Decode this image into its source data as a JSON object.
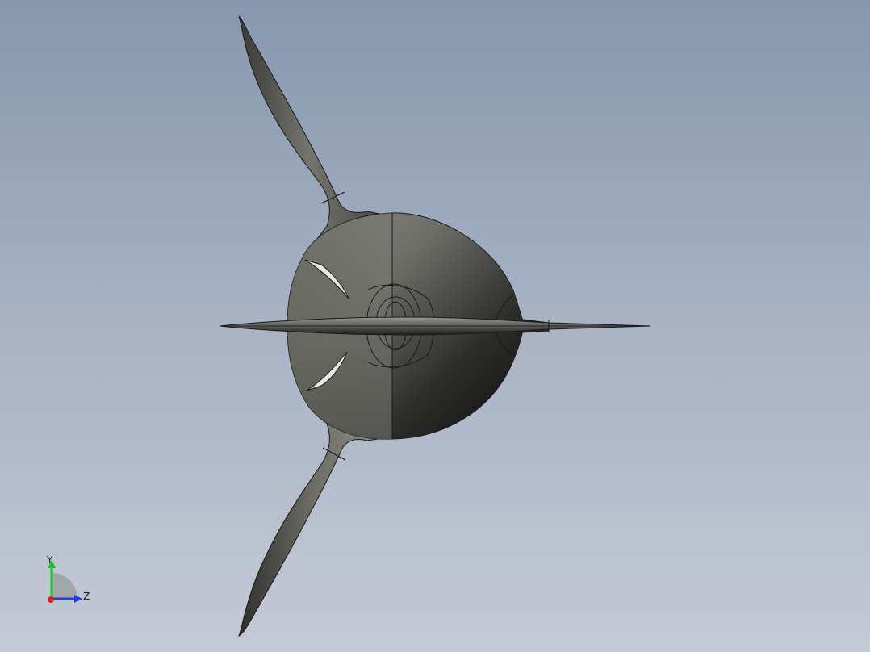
{
  "viewport": {
    "background_top": "#8797ad",
    "background_bottom": "#c4cad6"
  },
  "model": {
    "description_icon": "propeller-model-icon",
    "shade_light": "#8a8a84",
    "shade_dark": "#141414",
    "edge_color": "#1a1a1a"
  },
  "triad": {
    "y_label": "Y",
    "z_label": "Z",
    "y_axis_color": "#1fbf2a",
    "z_axis_color": "#1f3fe0",
    "x_axis_color": "#e02020"
  }
}
